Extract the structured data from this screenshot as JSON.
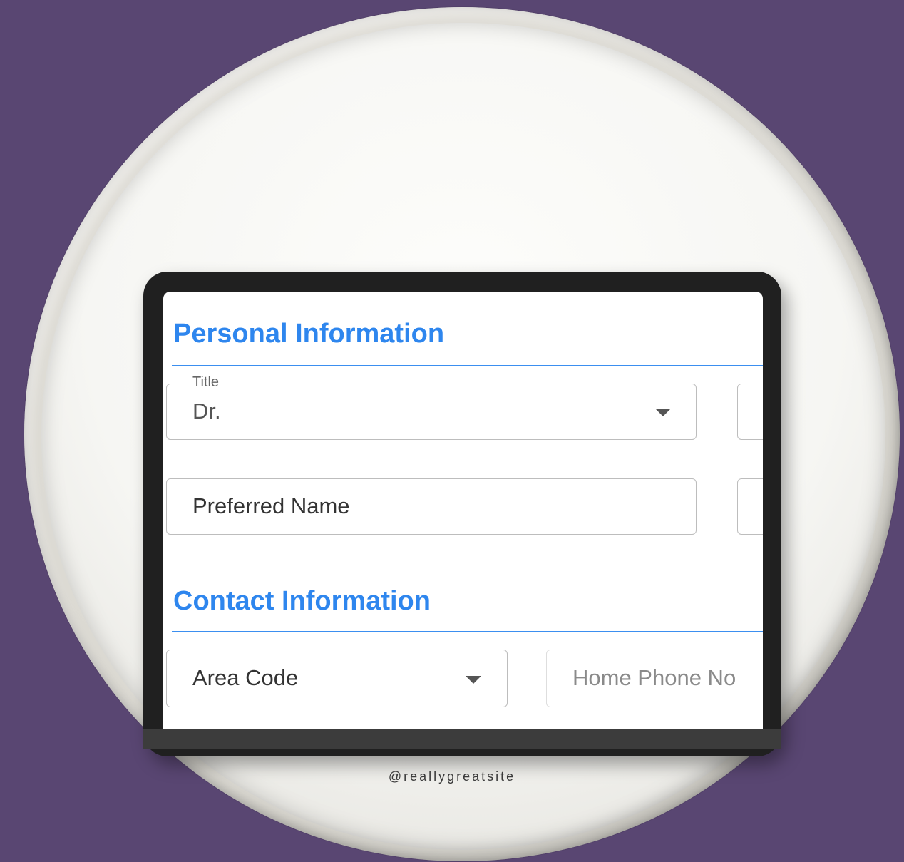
{
  "form": {
    "sections": {
      "personal": {
        "title": "Personal Information",
        "title_field": {
          "label": "Title",
          "value": "Dr."
        },
        "preferred_name_field": {
          "placeholder": "Preferred Name"
        }
      },
      "contact": {
        "title": "Contact Information",
        "area_code_field": {
          "placeholder": "Area Code"
        },
        "home_phone_field": {
          "placeholder": "Home Phone No"
        }
      }
    }
  },
  "watermark": "@reallygreatsite",
  "colors": {
    "background": "#594672",
    "accent": "#2e86ee",
    "tablet_frame": "#202020"
  },
  "icons": {
    "dropdown": "chevron-down-icon"
  }
}
